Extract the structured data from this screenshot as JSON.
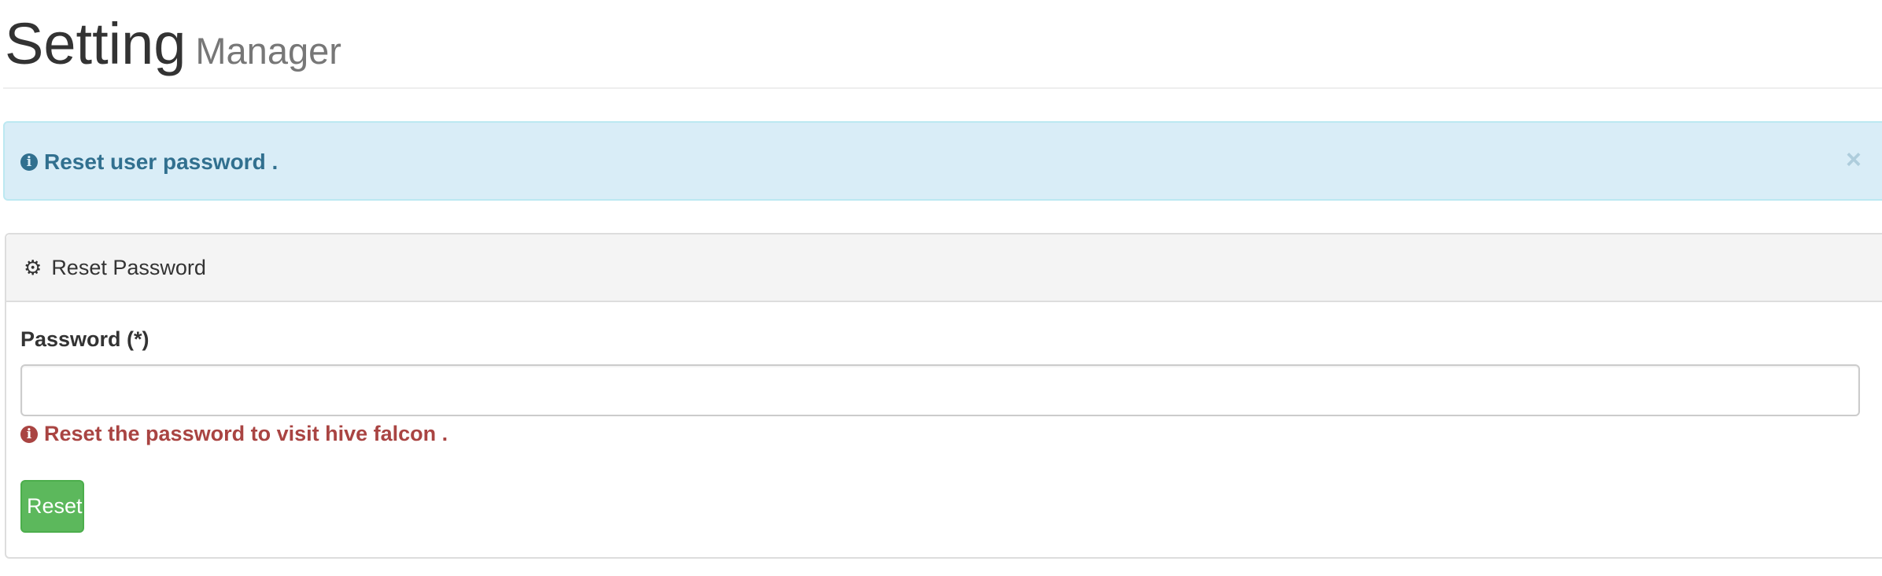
{
  "header": {
    "title": "Setting",
    "subtitle": "Manager"
  },
  "alert": {
    "icon": "info-circle-icon",
    "message": "Reset user password .",
    "close_label": "×"
  },
  "panel": {
    "icon": "gear-icon",
    "title": "Reset Password",
    "field_label": "Password (*)",
    "password_value": "",
    "error_icon": "info-circle-icon",
    "error_message": "Reset the password to visit hive falcon .",
    "submit_label": "Reset"
  },
  "colors": {
    "info_bg": "#d9edf7",
    "info_text": "#31708f",
    "error": "#a94442",
    "success": "#5cb85c"
  }
}
